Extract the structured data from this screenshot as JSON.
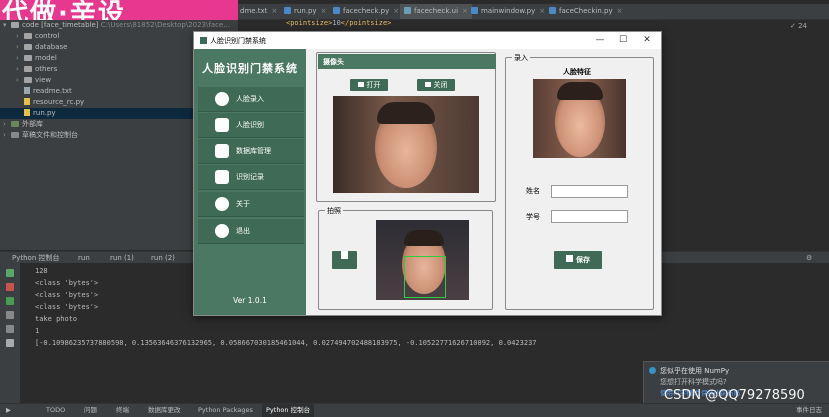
{
  "banner": {
    "text": "代做·辛设"
  },
  "editor_tabs": [
    {
      "label": "dme.txt"
    },
    {
      "label": "run.py"
    },
    {
      "label": "facecheck.py"
    },
    {
      "label": "facecheck.ui"
    },
    {
      "label": "mainwindow.py"
    },
    {
      "label": "faceCheckin.py"
    }
  ],
  "editor": {
    "code_open": "<pointsize>",
    "code_value": "10",
    "code_close": "</pointsize>",
    "gutter_hint": "✓ 24"
  },
  "project_tree": {
    "root": "code [face_timetable]",
    "root_path": "C:\\Users\\81852\\Desktop\\2023\\face...",
    "items": [
      {
        "label": "control",
        "kind": "folder"
      },
      {
        "label": "database",
        "kind": "folder"
      },
      {
        "label": "model",
        "kind": "folder"
      },
      {
        "label": "others",
        "kind": "folder"
      },
      {
        "label": "view",
        "kind": "folder"
      },
      {
        "label": "readme.txt",
        "kind": "file"
      },
      {
        "label": "resource_rc.py",
        "kind": "py"
      },
      {
        "label": "run.py",
        "kind": "py"
      }
    ],
    "external": "外部库",
    "scratch": "草稿文件和控制台"
  },
  "run_tabs": [
    {
      "label": "Python 控制台"
    },
    {
      "label": "run"
    },
    {
      "label": "run (1)"
    },
    {
      "label": "run (2)"
    }
  ],
  "console": {
    "lines": [
      "128",
      "<class 'bytes'>",
      "<class 'bytes'>",
      "<class 'bytes'>",
      "take photo",
      "1",
      "[-0.10986235737880598, 0.13563646376132965, 0.058667030185461044, 0.027494702488183975, -0.10522771626710892, 0.0423237"
    ]
  },
  "notification": {
    "title": "您似乎在使用 NumPy",
    "body": "您想打开科学模式吗?",
    "link": "使用科学模式  保持当前布局"
  },
  "bottom_tabs": [
    {
      "label": "TODO"
    },
    {
      "label": "问题"
    },
    {
      "label": "终端"
    },
    {
      "label": "数据库更改"
    },
    {
      "label": "Python Packages"
    },
    {
      "label": "Python 控制台"
    }
  ],
  "bottom_right": "事件日志",
  "watermark": "CSDN @QQ79278590",
  "app": {
    "window_title": "人脸识别门禁系统",
    "window_controls": {
      "minimize": "—",
      "maximize": "☐",
      "close": "✕"
    },
    "sidebar_title": "人脸识别门禁系统",
    "sidebar": [
      {
        "label": "人脸录入",
        "icon": "user-add-icon"
      },
      {
        "label": "人脸识别",
        "icon": "face-scan-icon"
      },
      {
        "label": "数据库管理",
        "icon": "database-icon"
      },
      {
        "label": "识别记录",
        "icon": "records-icon"
      },
      {
        "label": "关于",
        "icon": "info-icon"
      },
      {
        "label": "退出",
        "icon": "exit-icon"
      }
    ],
    "version": "Ver 1.0.1",
    "camera": {
      "header": "摄像头",
      "open_label": "打开",
      "close_label": "关闭"
    },
    "capture": {
      "group_title": "拍照"
    },
    "enroll": {
      "group_title": "录入",
      "feature_title": "人脸特征",
      "name_label": "姓名",
      "id_label": "学号",
      "name_value": "",
      "id_value": "",
      "save_label": "保存"
    }
  }
}
